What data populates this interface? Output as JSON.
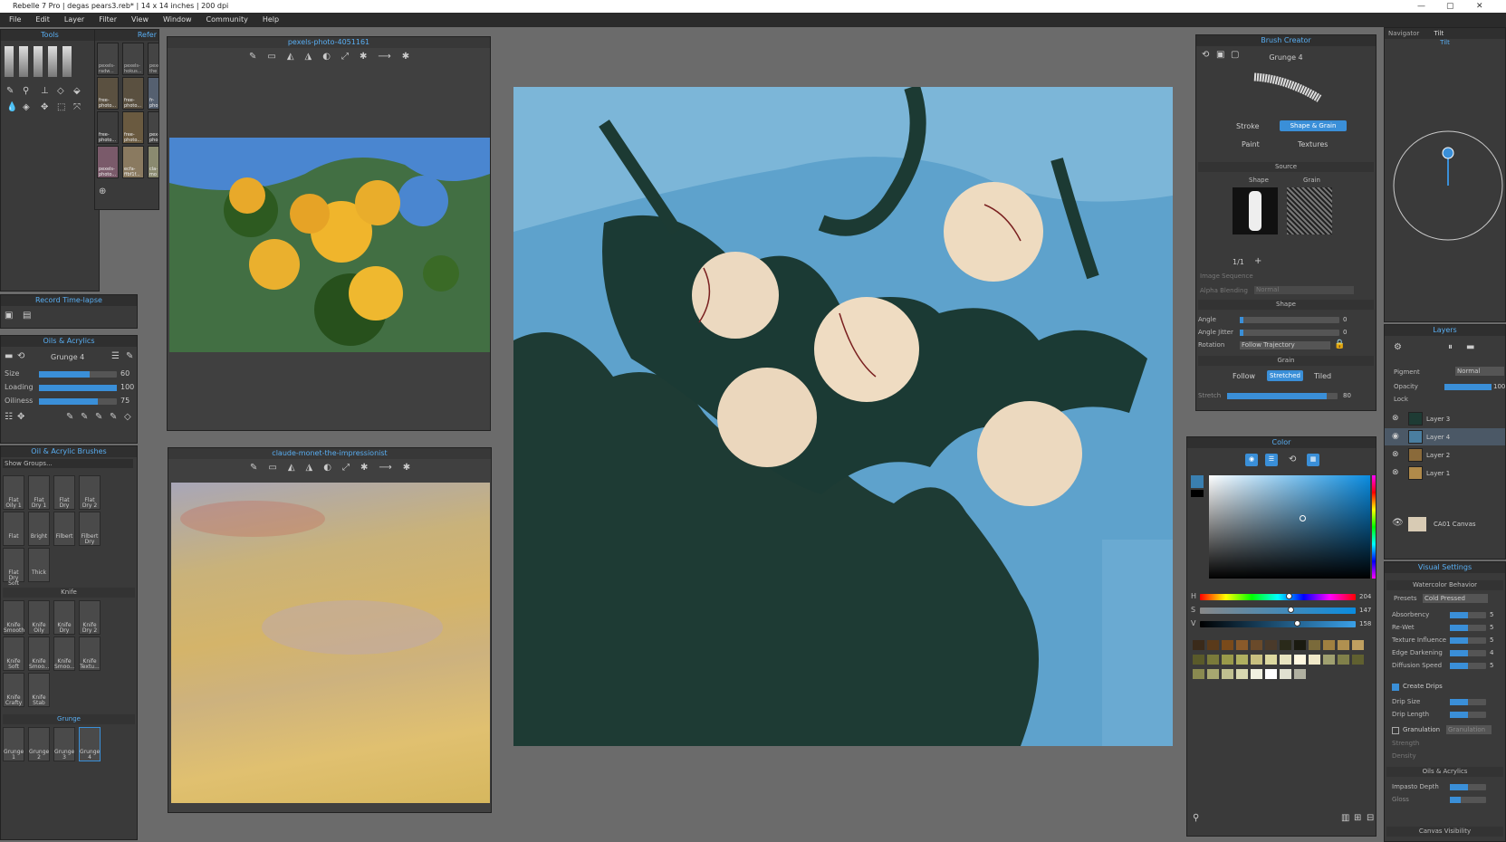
{
  "title": "Rebelle 7 Pro | degas pears3.reb* | 14 x 14 inches | 200 dpi",
  "menu": [
    "File",
    "Edit",
    "Layer",
    "Filter",
    "View",
    "Window",
    "Community",
    "Help"
  ],
  "tools": {
    "title": "Tools"
  },
  "reference": {
    "title": "Refer",
    "items": [
      [
        "pexels-radw...",
        "pexels-hokus...",
        "pexels-the"
      ],
      [
        "free-photo...",
        "free-photo...",
        "fr-pho"
      ],
      [
        "free-photo...",
        "free-photo...",
        "pex-pho"
      ],
      [
        "pexels-photo...",
        "ecfa-ffbf1f...",
        "cla-mo"
      ]
    ]
  },
  "ref1": {
    "title": "pexels-photo-4051161"
  },
  "ref2": {
    "title": "claude-monet-the-impressionist"
  },
  "record": {
    "title": "Record Time-lapse"
  },
  "oils": {
    "title": "Oils & Acrylics",
    "brush": "Grunge 4",
    "size_label": "Size",
    "size_val": "60",
    "size": 0.65,
    "loading_label": "Loading",
    "loading_val": "100",
    "loading": 1.0,
    "oiliness_label": "Oiliness",
    "oiliness_val": "75",
    "oiliness": 0.75
  },
  "brushes": {
    "title": "Oil & Acrylic Brushes",
    "groups": "Show Groups...",
    "row1": [
      "Flat Oily 1",
      "Flat Dry 1",
      "Flat Dry",
      "Flat Dry 2"
    ],
    "row2": [
      "Flat",
      "Bright",
      "Filbert",
      "Filbert Dry"
    ],
    "row3": [
      "Flat Dry Soft",
      "Thick"
    ],
    "knife": "Knife",
    "krow1": [
      "Knife Smooth",
      "Knife Oily",
      "Knife Dry",
      "Knife Dry 2"
    ],
    "krow2": [
      "Knife Soft",
      "Knife Smoo...",
      "Knife Smoo...",
      "Knife Textu..."
    ],
    "krow3": [
      "Knife Crafty",
      "Knife Stab"
    ],
    "grunge": "Grunge",
    "grow": [
      "Grunge 1",
      "Grunge 2",
      "Grunge 3",
      "Grunge 4"
    ]
  },
  "creator": {
    "title": "Brush Creator",
    "name": "Grunge 4",
    "stroke": "Stroke",
    "shape_grain": "Shape & Grain",
    "paint": "Paint",
    "textures": "Textures",
    "source": "Source",
    "shape_col": "Shape",
    "grain_col": "Grain",
    "count": "1/1",
    "seq": "Image Sequence",
    "alpha": "Alpha Blending",
    "alpha_val": "Normal",
    "shape_sec": "Shape",
    "angle": "Angle",
    "angle_val": "0",
    "jitter": "Angle Jitter",
    "jitter_val": "0",
    "rotation": "Rotation",
    "rotation_val": "Follow Trajectory",
    "grain_sec": "Grain",
    "follow": "Follow",
    "stretched": "Stretched",
    "tiled": "Tiled",
    "stretch": "Stretch",
    "stretch_val": "80"
  },
  "color": {
    "title": "Color",
    "h": "H",
    "s": "S",
    "v": "V",
    "h_val": "204",
    "s_val": "147",
    "v_val": "158",
    "h_pos": 0.57,
    "s_pos": 0.58,
    "v_pos": 0.62
  },
  "navigator": {
    "tab1": "Navigator",
    "tab2": "Tilt",
    "sub": "Tilt"
  },
  "layers": {
    "title": "Layers",
    "pigment": "Pigment",
    "blend": "Normal",
    "opacity": "Opacity",
    "opacity_val": "100",
    "lock": "Lock",
    "items": [
      "Layer 3",
      "Layer 4",
      "Layer 2",
      "Layer 1"
    ],
    "canvas": "CA01 Canvas"
  },
  "visual": {
    "title": "Visual Settings",
    "wc": "Watercolor Behavior",
    "presets": "Presets",
    "preset_val": "Cold Pressed",
    "rows": [
      [
        "Absorbency",
        "5"
      ],
      [
        "Re-Wet",
        "5"
      ],
      [
        "Texture Influence",
        "5"
      ],
      [
        "Edge Darkening",
        "4"
      ],
      [
        "Diffusion Speed",
        "5"
      ]
    ],
    "drips": "Create Drips",
    "drip_size": "Drip Size",
    "drip_len": "Drip Length",
    "gran": "Granulation",
    "gran_val": "Granulation",
    "strength": "Strength",
    "density": "Density",
    "oils": "Oils & Acrylics",
    "impasto": "Impasto Depth",
    "gloss": "Gloss",
    "canvas_vis": "Canvas Visibility"
  }
}
